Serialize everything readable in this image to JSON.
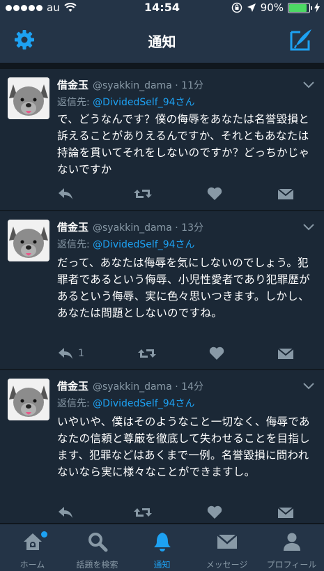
{
  "status_bar": {
    "carrier": "au",
    "time": "14:54",
    "battery": "90%",
    "battery_level": 0.9
  },
  "nav": {
    "title": "通知"
  },
  "tweets": [
    {
      "name": "借金玉",
      "meta": "@syakkin_dama · 11分",
      "reply_prefix": "返信先: ",
      "reply_handle": "@DividedSelf_94さん",
      "text": "で、どうなんです？僕の侮辱をあなたは名誉毀損と訴えることがありえるんですか、それともあなたは持論を貫いてそれをしないのですか？どっちかじゃないですか",
      "reply_count": ""
    },
    {
      "name": "借金玉",
      "meta": "@syakkin_dama · 13分",
      "reply_prefix": "返信先: ",
      "reply_handle": "@DividedSelf_94さん",
      "text": "だって、あなたは侮辱を気にしないのでしょう。犯罪者であるという侮辱、小児性愛者であり犯罪歴があるという侮辱、実に色々思いつきます。しかし、あなたは問題としないのですね。",
      "reply_count": "1"
    },
    {
      "name": "借金玉",
      "meta": "@syakkin_dama · 14分",
      "reply_prefix": "返信先: ",
      "reply_handle": "@DividedSelf_94さん",
      "text": "いやいや、僕はそのようなこと一切なく、侮辱であなたの信頼と尊厳を徹底して失わせることを目指します、犯罪などはあくまで一例。名誉毀損に問われないなら実に様々なことができますし。",
      "reply_count": ""
    }
  ],
  "tabs": [
    {
      "label": "ホーム",
      "icon": "home-icon"
    },
    {
      "label": "話題を検索",
      "icon": "search-icon"
    },
    {
      "label": "通知",
      "icon": "bell-icon"
    },
    {
      "label": "メッセージ",
      "icon": "envelope-icon"
    },
    {
      "label": "プロフィール",
      "icon": "person-icon"
    }
  ],
  "colors": {
    "accent": "#1da1f2",
    "background": "#141d26",
    "card": "#1b2836",
    "bar": "#243447",
    "muted": "#8899a6",
    "battery": "#4cd964"
  }
}
